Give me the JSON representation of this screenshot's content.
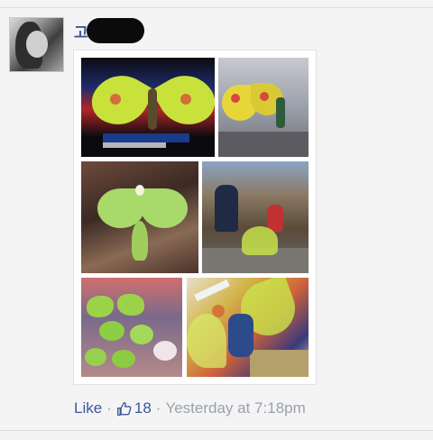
{
  "post": {
    "author": {
      "name_visible": "고",
      "name_redacted": true
    },
    "photo": {
      "type": "collage",
      "tiles": 6
    },
    "actions": {
      "like_label": "Like",
      "separator": "·",
      "like_count": "18",
      "timestamp": "Yesterday at 7:18pm"
    }
  },
  "colors": {
    "link": "#3b5998",
    "meta": "#9097a3",
    "background": "#f4f4f5"
  },
  "icons": {
    "like_count_icon": "thumbs-up-icon"
  }
}
